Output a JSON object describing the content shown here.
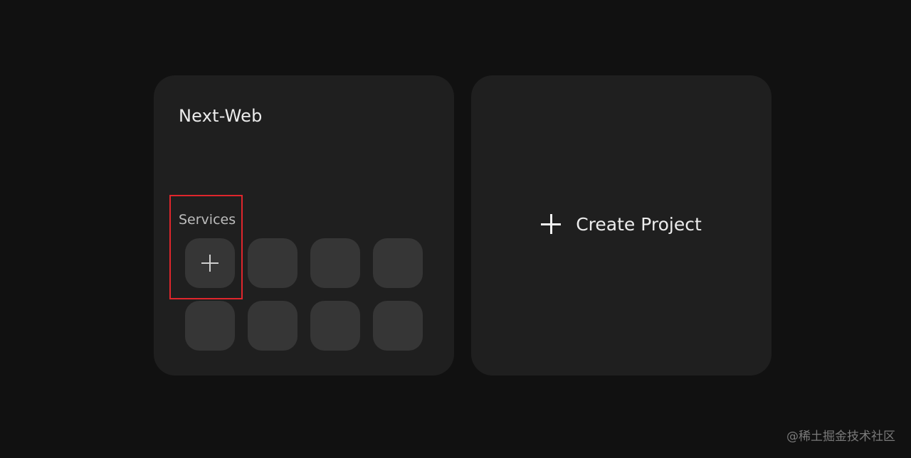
{
  "project_card": {
    "title": "Next-Web",
    "services_label": "Services",
    "add_service_icon": "plus-icon",
    "slot_count": 8
  },
  "create_card": {
    "icon": "plus-icon",
    "label": "Create Project"
  },
  "highlight": {
    "color": "#e0262c"
  },
  "watermark": "@稀土掘金技术社区"
}
